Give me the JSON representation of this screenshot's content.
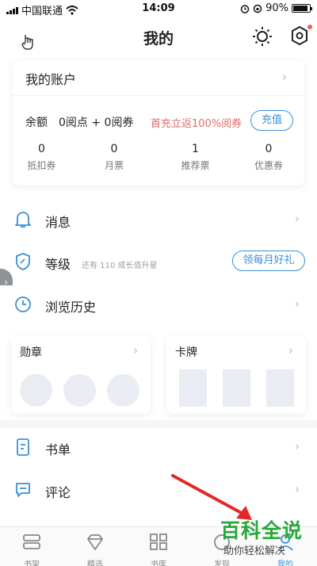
{
  "status_bar": {
    "carrier": "中国联通",
    "time": "14:09",
    "battery_text": "90%",
    "battery_level": 0.9
  },
  "header": {
    "title": "我的",
    "icons": [
      "cursor-icon",
      "sun-icon",
      "hexagon-icon"
    ]
  },
  "account": {
    "title": "我的账户",
    "balance_label": "余额",
    "points": "0阅点 + 0阅券",
    "promo": "首充立返100%阅券",
    "recharge_label": "充值",
    "stats": [
      {
        "value": "0",
        "label": "抵扣券"
      },
      {
        "value": "0",
        "label": "月票"
      },
      {
        "value": "1",
        "label": "推荐票"
      },
      {
        "value": "0",
        "label": "优惠券"
      }
    ]
  },
  "menu": {
    "messages": "消息",
    "level": "等级",
    "level_sub": "还有 110 成长值升星",
    "level_button": "领每月好礼",
    "history": "浏览历史",
    "booklist": "书单",
    "comments": "评论"
  },
  "cards": {
    "medals": "勋章",
    "cards": "卡牌"
  },
  "tabs": [
    {
      "label": "书架",
      "icon": "bookshelf-icon"
    },
    {
      "label": "精选",
      "icon": "diamond-icon"
    },
    {
      "label": "书库",
      "icon": "grid-icon"
    },
    {
      "label": "发现",
      "icon": "discover-icon"
    },
    {
      "label": "我的",
      "icon": "profile-icon",
      "active": true
    }
  ],
  "watermark": {
    "line1": "百科全说",
    "line2": "助你轻松解决"
  },
  "colors": {
    "accent": "#3c8fd8",
    "promo": "#e26a6a",
    "watermark": "#27a83a",
    "arrow": "#e02a2a"
  }
}
